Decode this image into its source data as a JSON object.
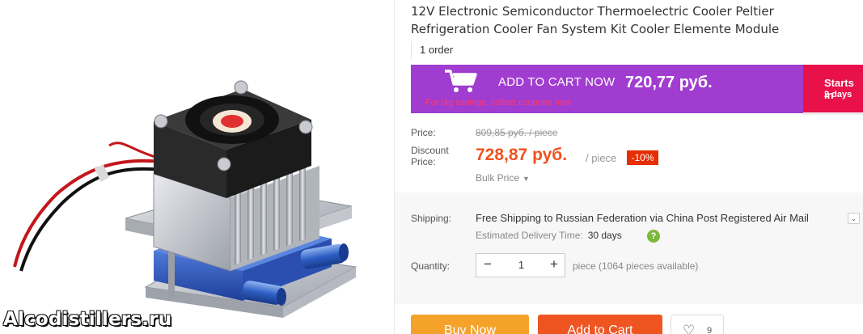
{
  "product": {
    "title": "12V Electronic Semiconductor Thermoelectric Cooler Peltier Refrigeration Cooler Fan System Kit Cooler Elemente Module",
    "orders": "1 order",
    "watermark": "Alcodistillers.ru"
  },
  "cart_banner": {
    "label": "ADD TO CART NOW",
    "price": "720,77 руб.",
    "note": "For big savings, collect coupons now.",
    "starts_line1": "Starts in",
    "starts_line2": "2 days"
  },
  "pricing": {
    "price_label": "Price:",
    "old_price": "809,85 руб. / piece",
    "discount_label_1": "Discount",
    "discount_label_2": "Price:",
    "discount_price": "728,87 руб.",
    "per_piece": "/ piece",
    "discount_badge": "-10%",
    "bulk_label": "Bulk Price"
  },
  "shipping": {
    "label": "Shipping:",
    "free_shipping": "Free Shipping",
    "to_text": "to Russian Federation via China Post Registered Air Mail",
    "estimated_label": "Estimated Delivery Time:",
    "estimated_value": "30 days"
  },
  "quantity": {
    "label": "Quantity:",
    "minus": "−",
    "value": "1",
    "plus": "+",
    "available": "piece (1064 pieces available)"
  },
  "actions": {
    "buy_now": "Buy Now",
    "add_to_cart": "Add to Cart",
    "wishlist_count": "9"
  },
  "colors": {
    "cart_banner": "#a03cd0",
    "starts_box": "#e8114a",
    "discount_price": "#f0521e",
    "buy_now": "#f5a22b",
    "add_to_cart": "#ef5521"
  }
}
